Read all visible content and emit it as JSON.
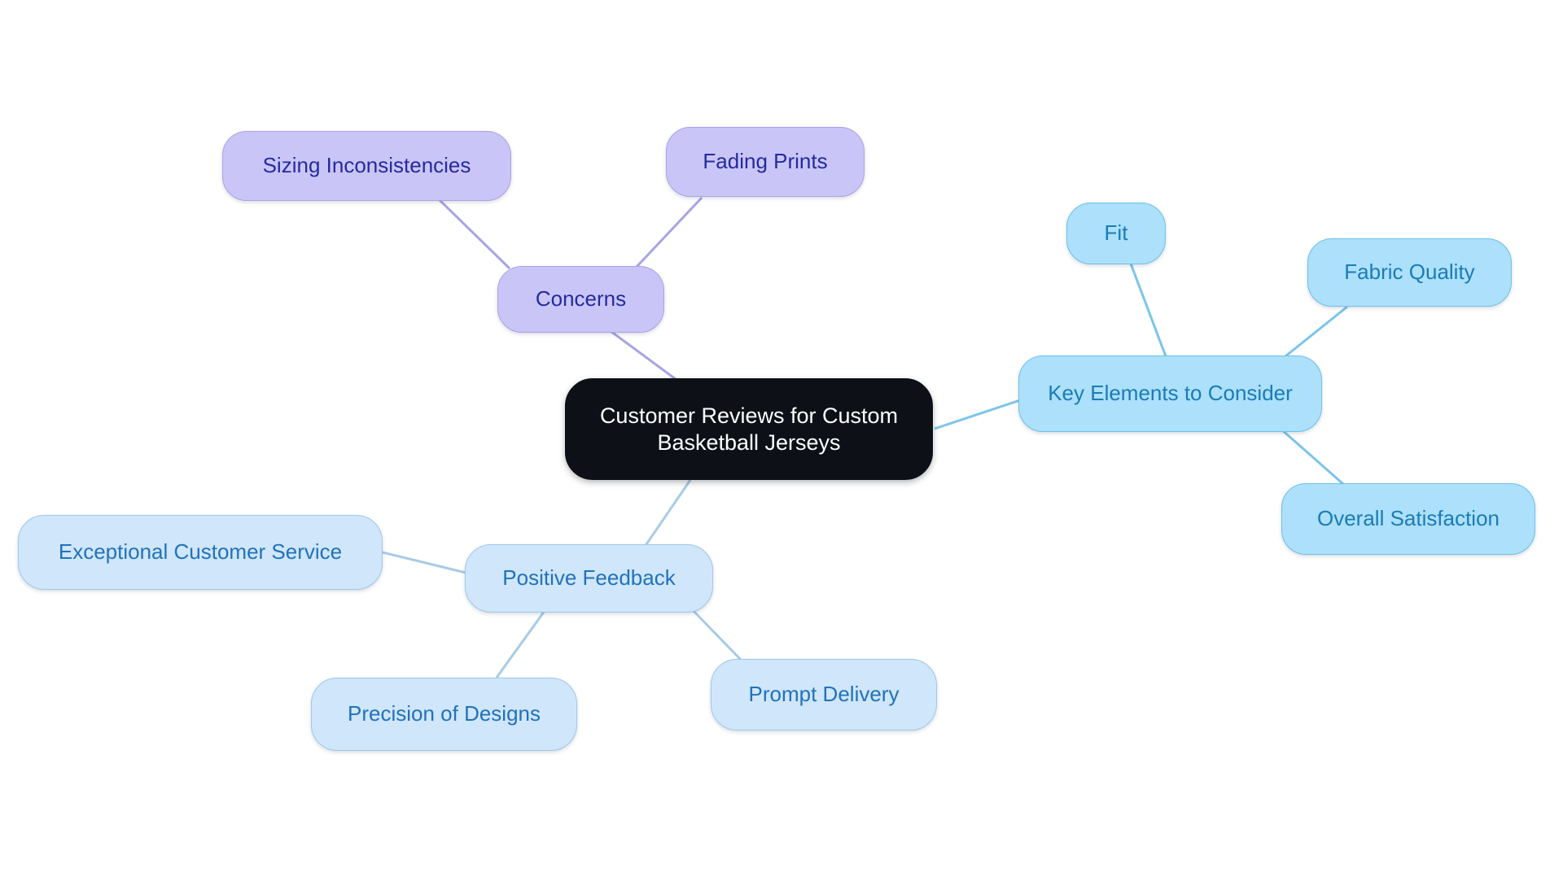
{
  "diagram": {
    "type": "mindmap",
    "title": "Customer Reviews for Custom Basketball Jerseys",
    "background_color": "#ffffff",
    "palette": {
      "root_fill": "#0d1117",
      "root_text": "#ffffff",
      "lavender_fill": "#c9c6f7",
      "lavender_border": "#a8a3e8",
      "lavender_text": "#262a9e",
      "sky_fill": "#ace0fb",
      "sky_border": "#6ec1ea",
      "sky_text": "#1b7cb5",
      "pale_fill": "#cfe6fb",
      "pale_border": "#9fc8ec",
      "pale_text": "#2272bb",
      "edge_lavender": "#a9a4e4",
      "edge_sky": "#7cc4ec",
      "edge_pale": "#a8cbe8"
    },
    "root": {
      "label": "Customer Reviews for Custom\nBasketball Jerseys"
    },
    "branches": [
      {
        "id": "concerns",
        "label": "Concerns",
        "color_family": "lavender",
        "children": [
          {
            "id": "sizing-inconsistencies",
            "label": "Sizing Inconsistencies"
          },
          {
            "id": "fading-prints",
            "label": "Fading Prints"
          }
        ]
      },
      {
        "id": "key-elements-to-consider",
        "label": "Key Elements to Consider",
        "color_family": "sky",
        "children": [
          {
            "id": "fit",
            "label": "Fit"
          },
          {
            "id": "fabric-quality",
            "label": "Fabric Quality"
          },
          {
            "id": "overall-satisfaction",
            "label": "Overall Satisfaction"
          }
        ]
      },
      {
        "id": "positive-feedback",
        "label": "Positive Feedback",
        "color_family": "pale",
        "children": [
          {
            "id": "exceptional-customer-service",
            "label": "Exceptional Customer Service"
          },
          {
            "id": "precision-of-designs",
            "label": "Precision of Designs"
          },
          {
            "id": "prompt-delivery",
            "label": "Prompt Delivery"
          }
        ]
      }
    ]
  }
}
